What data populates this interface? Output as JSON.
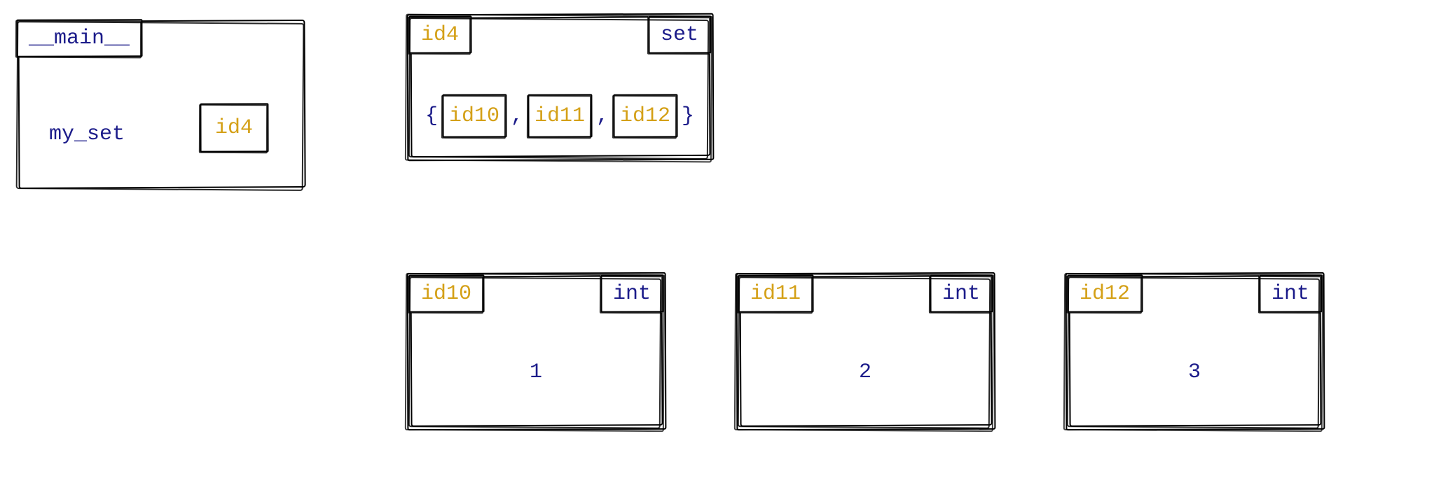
{
  "frame": {
    "label": "__main__",
    "var_name": "my_set",
    "var_ref": "id4"
  },
  "set_object": {
    "id": "id4",
    "type": "set",
    "open": "{",
    "close": "}",
    "sep": ",",
    "items": [
      "id10",
      "id11",
      "id12"
    ]
  },
  "ints": [
    {
      "id": "id10",
      "type": "int",
      "value": "1"
    },
    {
      "id": "id11",
      "type": "int",
      "value": "2"
    },
    {
      "id": "id12",
      "type": "int",
      "value": "3"
    }
  ]
}
